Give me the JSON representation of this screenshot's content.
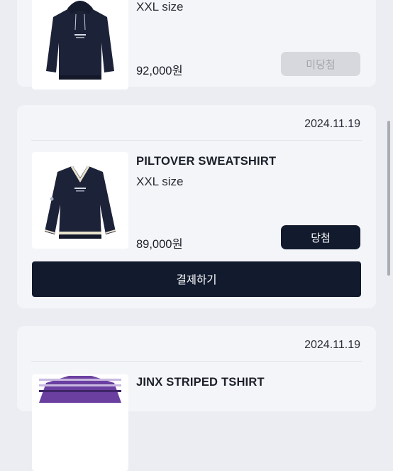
{
  "orders": [
    {
      "size": "XXL size",
      "price": "92,000원",
      "status": "미당첨",
      "product_image": "navy-hoodie"
    },
    {
      "date": "2024.11.19",
      "name": "PILTOVER SWEATSHIRT",
      "size": "XXL size",
      "price": "89,000원",
      "status": "당첨",
      "action": "결제하기",
      "product_image": "navy-v-neck-sweatshirt"
    },
    {
      "date": "2024.11.19",
      "name": "JINX STRIPED TSHIRT",
      "product_image": "purple-striped-tshirt"
    }
  ],
  "colors": {
    "background": "#ebedf2",
    "card": "#f4f5f8",
    "primary_button": "#121a2e",
    "disabled_button": "#d6d8dd",
    "garment_navy": "#1c2238",
    "stripe_purple": "#6a3fa0"
  }
}
